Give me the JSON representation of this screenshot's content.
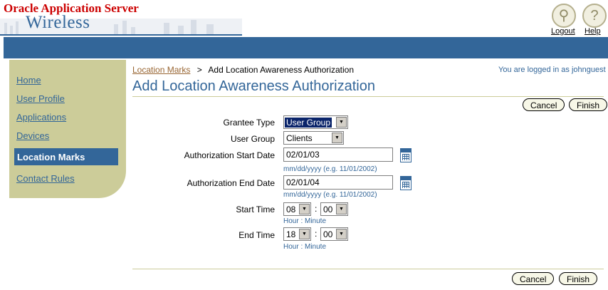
{
  "header": {
    "brand_top": "Oracle Application Server",
    "brand_bottom": "Wireless",
    "logout_label": "Logout",
    "help_label": "Help"
  },
  "sidebar": {
    "items": [
      {
        "label": "Home"
      },
      {
        "label": "User Profile"
      },
      {
        "label": "Applications"
      },
      {
        "label": "Devices"
      },
      {
        "label": "Location Marks"
      },
      {
        "label": "Contact Rules"
      }
    ],
    "active_index": 4
  },
  "breadcrumb": {
    "parent": "Location Marks",
    "separator": ">",
    "current": "Add Location Awareness Authorization"
  },
  "login_status": "You are logged in as johnguest",
  "page_title": "Add Location Awareness Authorization",
  "buttons": {
    "cancel": "Cancel",
    "finish": "Finish"
  },
  "form": {
    "grantee_type": {
      "label": "Grantee Type",
      "value": "User Group"
    },
    "user_group": {
      "label": "User Group",
      "value": "Clients"
    },
    "auth_start": {
      "label": "Authorization Start Date",
      "value": "02/01/03",
      "hint": "mm/dd/yyyy (e.g. 11/01/2002)"
    },
    "auth_end": {
      "label": "Authorization End Date",
      "value": "02/01/04",
      "hint": "mm/dd/yyyy (e.g. 11/01/2002)"
    },
    "start_time": {
      "label": "Start Time",
      "hour": "08",
      "minute": "00",
      "separator": ":",
      "hint": "Hour : Minute"
    },
    "end_time": {
      "label": "End Time",
      "hour": "18",
      "minute": "00",
      "separator": ":",
      "hint": "Hour : Minute"
    }
  },
  "colors": {
    "brand_blue": "#336699",
    "tan": "#cccc99",
    "oracle_red": "#cc0000",
    "link_brown": "#996633"
  }
}
